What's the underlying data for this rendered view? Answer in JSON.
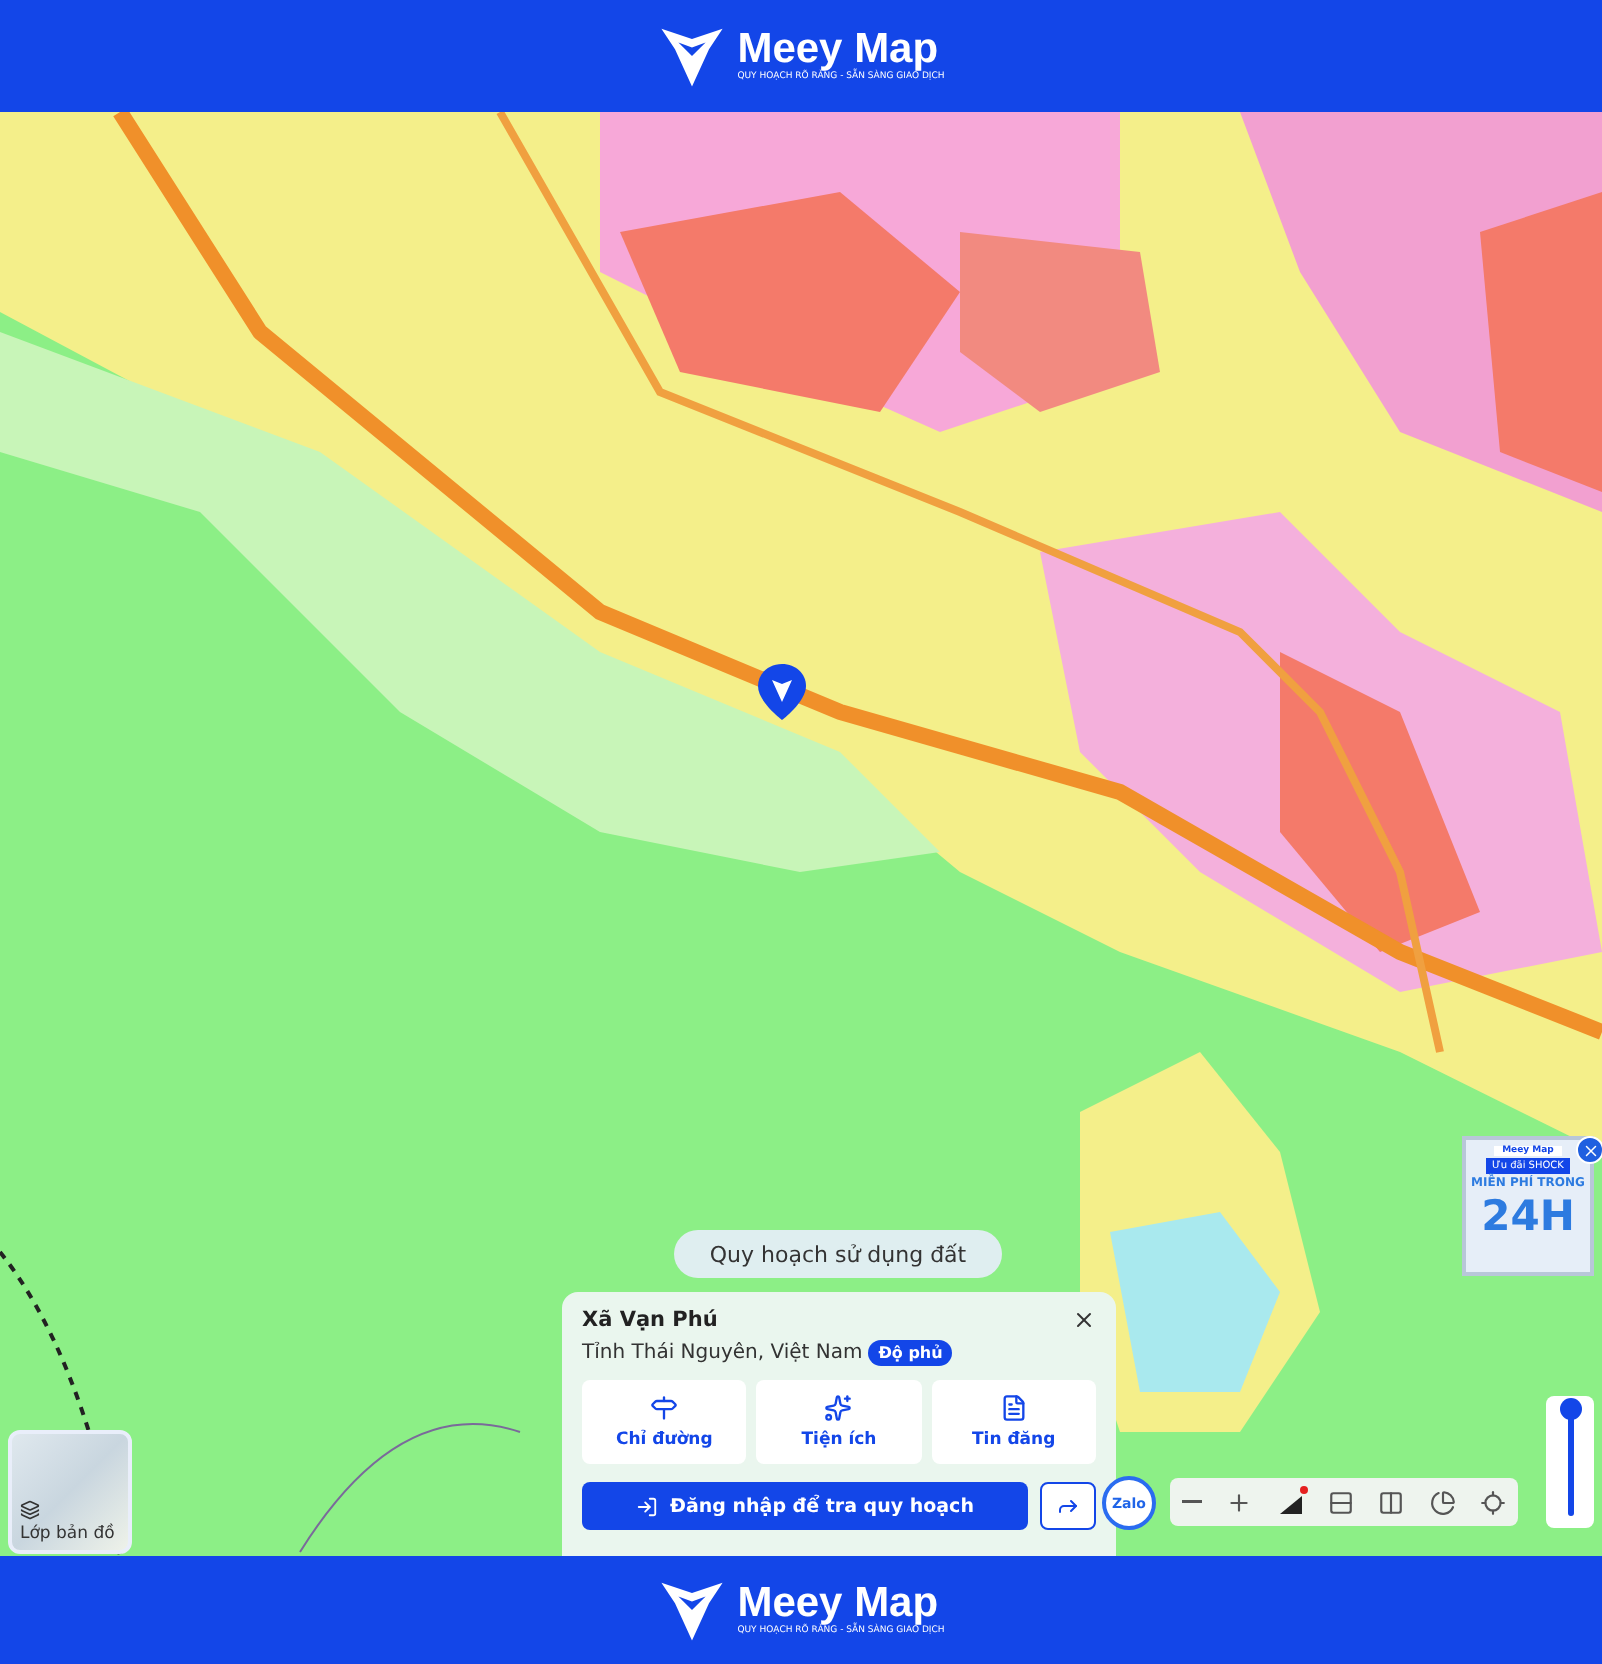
{
  "header": {
    "brand": "Meey Map",
    "tagline": "QUY HOẠCH RÕ RÀNG - SẴN SÀNG GIAO DỊCH"
  },
  "map": {
    "layer_chip": "Quy hoạch sử dụng đất"
  },
  "place_card": {
    "title": "Xã Vạn Phú",
    "subtitle": "Tỉnh Thái Nguyên, Việt Nam",
    "badge": "Độ phủ",
    "login_button": "Đăng nhập để tra quy hoạch",
    "actions": [
      {
        "kind": "directions",
        "label": "Chỉ đường"
      },
      {
        "kind": "amenities",
        "label": "Tiện ích"
      },
      {
        "kind": "listings",
        "label": "Tin đăng"
      }
    ]
  },
  "layer_button": {
    "label": "Lớp bản đồ"
  },
  "zalo_button": {
    "label": "Zalo"
  },
  "toolbar": {
    "tools": [
      {
        "kind": "zoom-out"
      },
      {
        "kind": "zoom-in"
      },
      {
        "kind": "map-style"
      },
      {
        "kind": "split"
      },
      {
        "kind": "compare"
      },
      {
        "kind": "chart"
      },
      {
        "kind": "locate"
      }
    ]
  },
  "opacity_slider": {
    "level": 1
  },
  "promo": {
    "brand": "Meey Map",
    "tag": "Ưu đãi SHOCK",
    "headline": "MIỄN PHÍ TRONG",
    "big": "24H"
  },
  "footer": {
    "brand": "Meey Map",
    "tagline": "QUY HOẠCH RÕ RÀNG - SẴN SÀNG GIAO DỊCH"
  }
}
